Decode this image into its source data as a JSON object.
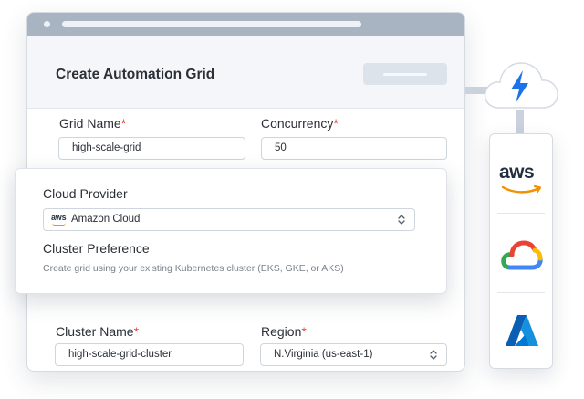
{
  "header": {
    "title": "Create Automation Grid"
  },
  "fields": {
    "grid_name": {
      "label": "Grid Name",
      "required": "*",
      "value": "high-scale-grid"
    },
    "concurrency": {
      "label": "Concurrency",
      "required": "*",
      "value": "50"
    },
    "cluster_name": {
      "label": "Cluster Name",
      "required": "*",
      "value": "high-scale-grid-cluster"
    },
    "region": {
      "label": "Region",
      "required": "*",
      "value": "N.Virginia (us-east-1)"
    }
  },
  "card": {
    "cloud_provider_label": "Cloud Provider",
    "cloud_provider_badge": "aws",
    "cloud_provider_value": "Amazon Cloud",
    "cluster_pref_label": "Cluster Preference",
    "cluster_pref_desc": "Create grid using  your existing Kubernetes cluster (EKS, GKE, or AKS)"
  },
  "providers": {
    "aws_logo_text": "aws"
  },
  "colors": {
    "required": "#e1473a",
    "bolt": "#1a73e8",
    "aws_orange": "#f29100",
    "aws_dark": "#232f3e",
    "azure_blue": "#0078d4"
  },
  "icons": [
    "lightning-cloud-icon",
    "aws-logo-icon",
    "google-cloud-logo-icon",
    "azure-logo-icon",
    "chevron-updown-icon"
  ]
}
